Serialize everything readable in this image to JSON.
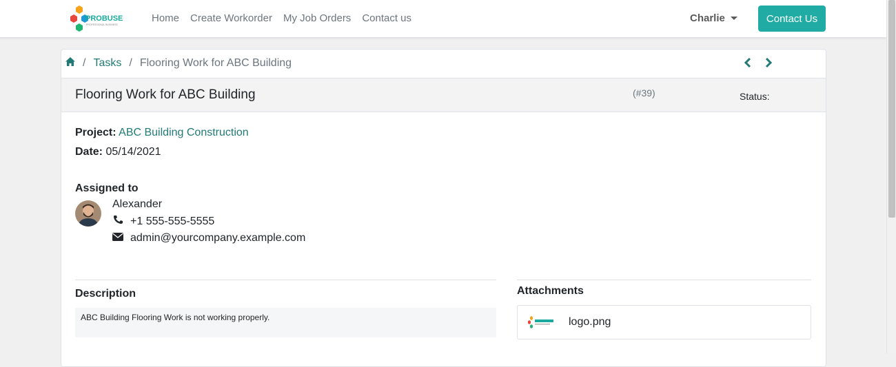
{
  "nav": {
    "logo_text": "PROBUSE",
    "logo_tagline": "PROFESSIONAL BUSINESS",
    "links": [
      "Home",
      "Create Workorder",
      "My Job Orders",
      "Contact us"
    ],
    "user": "Charlie",
    "contact_button": "Contact Us"
  },
  "breadcrumb": {
    "home_icon": "home-icon",
    "separator": "/",
    "tasks": "Tasks",
    "current": "Flooring Work for ABC Building"
  },
  "task": {
    "title": "Flooring Work for ABC Building",
    "ref": "(#39)",
    "status_label": "Status:",
    "project_label": "Project:",
    "project": "ABC Building Construction",
    "date_label": "Date:",
    "date": "05/14/2021"
  },
  "assigned": {
    "heading": "Assigned to",
    "name": "Alexander",
    "phone": "+1 555-555-5555",
    "email": "admin@yourcompany.example.com"
  },
  "description": {
    "heading": "Description",
    "text": "ABC Building Flooring Work is not working properly."
  },
  "attachments": {
    "heading": "Attachments",
    "files": [
      "logo.png"
    ]
  },
  "colors": {
    "accent": "#20aca4",
    "link": "#217a75"
  }
}
